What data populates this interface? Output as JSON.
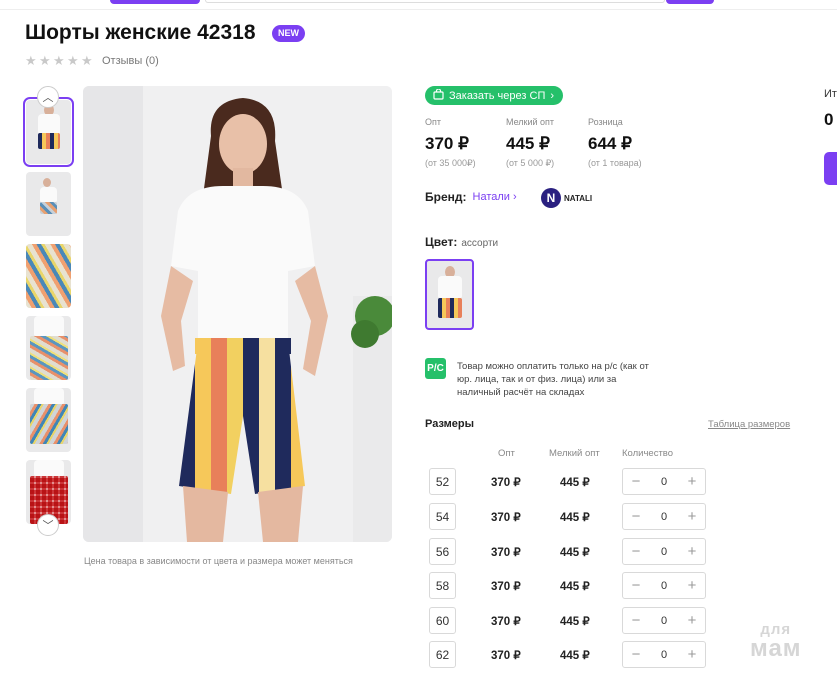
{
  "product": {
    "title": "Шорты женские 42318",
    "badge": "NEW",
    "reviews": "Отзывы (0)",
    "rating_stars": 0
  },
  "gallery": {
    "caption": "Цена товара в зависимости от цвета и размера может меняться"
  },
  "order": {
    "sp_button": "Заказать через СП"
  },
  "prices": [
    {
      "label": "Опт",
      "value": "370 ₽",
      "note": "(от 35 000₽)"
    },
    {
      "label": "Мелкий опт",
      "value": "445 ₽",
      "note": "(от 5 000 ₽)"
    },
    {
      "label": "Розница",
      "value": "644 ₽",
      "note": "(от 1 товара)"
    }
  ],
  "brand": {
    "label": "Бренд:",
    "name": "Натали",
    "logo_letter": "N",
    "logo_text": "NATALI"
  },
  "color": {
    "label": "Цвет:",
    "value": "ассорти"
  },
  "payment": {
    "icon_text": "P/C",
    "text": "Товар можно оплатить только на р/с (как от юр. лица, так и от физ. лица) или за наличный расчёт на складах"
  },
  "sizes": {
    "title": "Размеры",
    "table_link": "Таблица размеров",
    "headers": {
      "opt": "Опт",
      "small": "Мелкий опт",
      "qty": "Количество"
    },
    "rows": [
      {
        "size": "52",
        "opt": "370 ₽",
        "small": "445 ₽",
        "qty": "0"
      },
      {
        "size": "54",
        "opt": "370 ₽",
        "small": "445 ₽",
        "qty": "0"
      },
      {
        "size": "56",
        "opt": "370 ₽",
        "small": "445 ₽",
        "qty": "0"
      },
      {
        "size": "58",
        "opt": "370 ₽",
        "small": "445 ₽",
        "qty": "0"
      },
      {
        "size": "60",
        "opt": "370 ₽",
        "small": "445 ₽",
        "qty": "0"
      },
      {
        "size": "62",
        "opt": "370 ₽",
        "small": "445 ₽",
        "qty": "0"
      }
    ]
  },
  "summary": {
    "label": "Ит",
    "value": "0"
  },
  "watermark": {
    "line1": "для",
    "line2": "мам"
  },
  "colors": {
    "accent": "#7b3ff2",
    "green": "#25c06a"
  }
}
